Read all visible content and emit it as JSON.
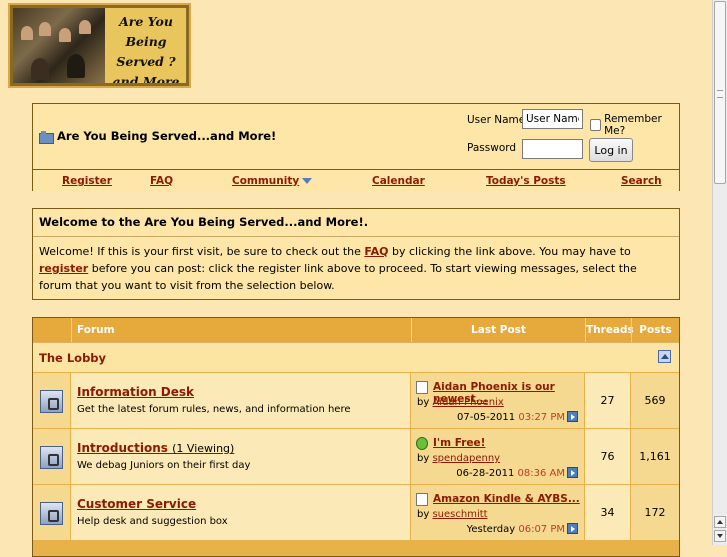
{
  "logo": {
    "lines": [
      "Are You Being",
      "Served ?",
      "and More !!!!!"
    ]
  },
  "header": {
    "breadcrumb": "Are You Being Served...and More!"
  },
  "login": {
    "username_label": "User Name",
    "username_value": "User Name",
    "remember_label": "Remember Me?",
    "password_label": "Password",
    "login_button": "Log in"
  },
  "nav": {
    "register": "Register",
    "faq": "FAQ",
    "community": "Community",
    "calendar": "Calendar",
    "todays_posts": "Today's Posts",
    "search": "Search"
  },
  "welcome": {
    "title": "Welcome to the Are You Being Served...and More!.",
    "text1": "Welcome! If this is your first visit, be sure to check out the ",
    "faq_link": "FAQ",
    "text2": " by clicking the link above. You may have to ",
    "register_link": "register",
    "text3": " before you can post: click the register link above to proceed. To start viewing messages, select the forum that you want to visit from the selection below."
  },
  "forum_table": {
    "headers": {
      "forum": "Forum",
      "last_post": "Last Post",
      "threads": "Threads",
      "posts": "Posts"
    },
    "category": "The Lobby",
    "rows": [
      {
        "title": "Information Desk",
        "viewing": "",
        "description": "Get the latest forum rules, news, and information here",
        "last_post_title": "Aidan Phoenix is our newest...",
        "by_label": "by",
        "author": "Aidan Phoenix",
        "date": "07-05-2011",
        "time": "03:27 PM",
        "threads": "27",
        "posts": "569",
        "icon": "document-icon"
      },
      {
        "title": "Introductions",
        "viewing": "(1 Viewing)",
        "description": "We debag Juniors on their first day",
        "last_post_title": "I'm Free!",
        "by_label": "by",
        "author": "spendapenny",
        "date": "06-28-2011",
        "time": "08:36 AM",
        "threads": "76",
        "posts": "1,161",
        "icon": "smile-icon"
      },
      {
        "title": "Customer Service",
        "viewing": "",
        "description": "Help desk and suggestion box",
        "last_post_title": "Amazon Kindle & AYBS...",
        "by_label": "by",
        "author": "sueschmitt",
        "date": "Yesterday",
        "time": "06:07 PM",
        "threads": "34",
        "posts": "172",
        "icon": "document-icon"
      }
    ]
  }
}
